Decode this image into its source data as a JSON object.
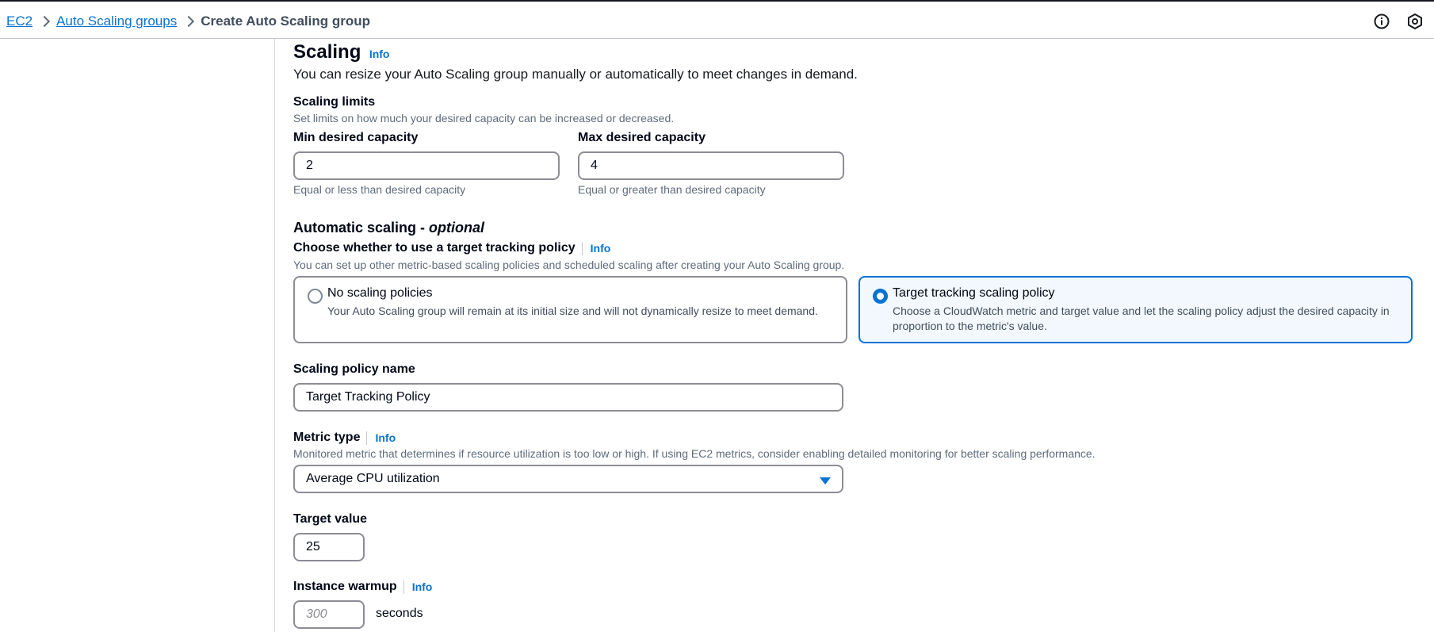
{
  "breadcrumb": {
    "items": [
      "EC2",
      "Auto Scaling groups"
    ],
    "current": "Create Auto Scaling group"
  },
  "header_icons": [
    "info-icon",
    "settings-icon"
  ],
  "scaling": {
    "title": "Scaling",
    "info": "Info",
    "description": "You can resize your Auto Scaling group manually or automatically to meet changes in demand."
  },
  "limits": {
    "title": "Scaling limits",
    "description": "Set limits on how much your desired capacity can be increased or decreased.",
    "min_label": "Min desired capacity",
    "min_value": "2",
    "min_hint": "Equal or less than desired capacity",
    "max_label": "Max desired capacity",
    "max_value": "4",
    "max_hint": "Equal or greater than desired capacity"
  },
  "automatic": {
    "title": "Automatic scaling - ",
    "title_italic": "optional",
    "choose_label": "Choose whether to use a target tracking policy",
    "info": "Info",
    "choose_description": "You can set up other metric-based scaling policies and scheduled scaling after creating your Auto Scaling group.",
    "options": [
      {
        "title": "No scaling policies",
        "description": "Your Auto Scaling group will remain at its initial size and will not dynamically resize to meet demand.",
        "selected": false
      },
      {
        "title": "Target tracking scaling policy",
        "description": "Choose a CloudWatch metric and target value and let the scaling policy adjust the desired capacity in proportion to the metric's value.",
        "selected": true
      }
    ]
  },
  "policy": {
    "name_label": "Scaling policy name",
    "name_value": "Target Tracking Policy",
    "metric_label": "Metric type",
    "metric_info": "Info",
    "metric_description": "Monitored metric that determines if resource utilization is too low or high. If using EC2 metrics, consider enabling detailed monitoring for better scaling performance.",
    "metric_value": "Average CPU utilization",
    "target_label": "Target value",
    "target_value": "25",
    "warmup_label": "Instance warmup",
    "warmup_info": "Info",
    "warmup_placeholder": "300",
    "warmup_unit": "seconds"
  },
  "colors": {
    "link": "#0972d3",
    "selected_tile_bg": "#f2f8fd",
    "border": "#8c8c94"
  }
}
